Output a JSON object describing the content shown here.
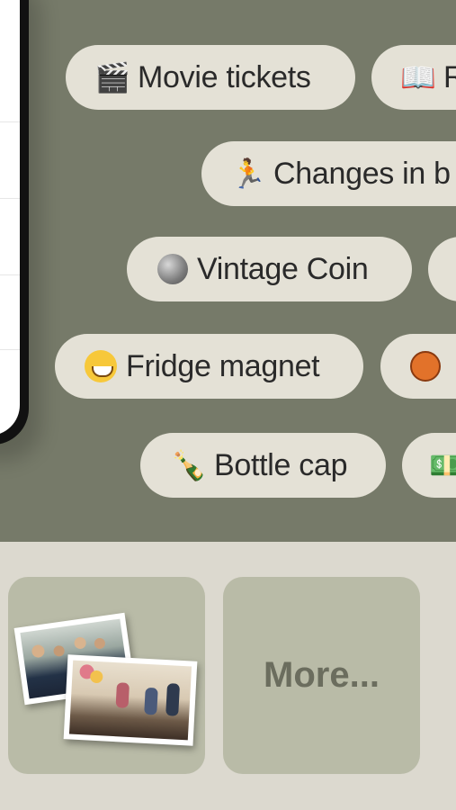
{
  "chips": [
    {
      "label": "Movie tickets",
      "icon": "clapperboard-icon",
      "glyph": "🎬"
    },
    {
      "label": "R",
      "icon": "open-book-icon",
      "glyph": "📖"
    },
    {
      "label": "Changes in b",
      "icon": "runner-icon",
      "glyph": "🏃"
    },
    {
      "label": "Vintage Coin",
      "icon": "coin-icon",
      "glyph": ""
    },
    {
      "label": "Fridge magnet",
      "icon": "grinning-face-icon",
      "glyph": ""
    },
    {
      "label": "",
      "icon": "basketball-icon",
      "glyph": ""
    },
    {
      "label": "Bottle cap",
      "icon": "champagne-bottle-icon",
      "glyph": "🍾"
    },
    {
      "label": "",
      "icon": "banknote-icon",
      "glyph": "💵"
    }
  ],
  "cards": {
    "more_label": "More..."
  },
  "colors": {
    "panel": "#767a69",
    "chip": "#e4e1d6",
    "card": "#b9bba7",
    "background": "#dcd9cf"
  }
}
